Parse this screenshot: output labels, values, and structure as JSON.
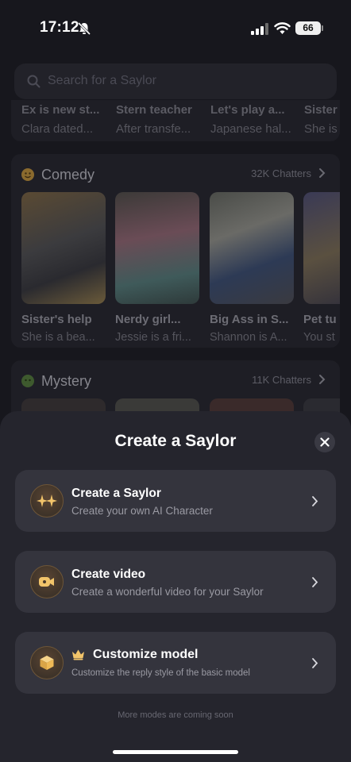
{
  "status_bar": {
    "time": "17:12",
    "battery": "66"
  },
  "search": {
    "placeholder": "Search for a Saylor"
  },
  "top_row": [
    {
      "title": "Ex is new st...",
      "subtitle": "Clara dated..."
    },
    {
      "title": "Stern teacher",
      "subtitle": "After transfe..."
    },
    {
      "title": "Let's play a...",
      "subtitle": "Japanese hal..."
    },
    {
      "title": "Sister",
      "subtitle": "She is"
    }
  ],
  "comedy": {
    "title": "Comedy",
    "count": "32K Chatters",
    "cards": [
      {
        "title": "Sister's help",
        "subtitle": "She is a bea..."
      },
      {
        "title": "Nerdy girl...",
        "subtitle": "Jessie is a fri..."
      },
      {
        "title": "Big Ass in S...",
        "subtitle": "Shannon is A..."
      },
      {
        "title": "Pet tu",
        "subtitle": "You st"
      }
    ]
  },
  "mystery": {
    "title": "Mystery",
    "count": "11K Chatters"
  },
  "sheet": {
    "title": "Create a Saylor",
    "options": [
      {
        "title": "Create a Saylor",
        "subtitle": "Create your own AI Character",
        "icon": "sparkles-icon"
      },
      {
        "title": "Create video",
        "subtitle": "Create a wonderful video for your Saylor",
        "icon": "video-camera-icon"
      },
      {
        "title": "Customize model",
        "subtitle": "Customize the reply style of the basic model",
        "icon": "cube-icon"
      }
    ],
    "footer": "More modes are coming soon"
  },
  "colors": {
    "accent": "#f2c46a",
    "sheet_bg": "#25252d",
    "card_bg": "#34343d"
  }
}
